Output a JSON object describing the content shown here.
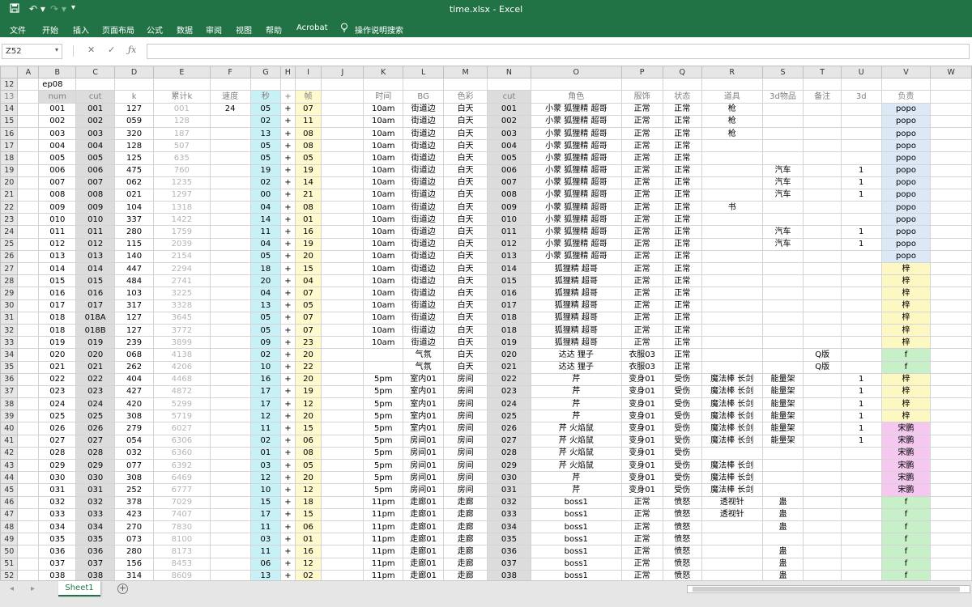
{
  "window": {
    "title": "time.xlsx",
    "separator": "-",
    "app": "Excel"
  },
  "ribbon_tabs": [
    "文件",
    "开始",
    "插入",
    "页面布局",
    "公式",
    "数据",
    "审阅",
    "视图",
    "帮助",
    "Acrobat"
  ],
  "tell_me": "操作说明搜索",
  "name_box": "Z52",
  "sheet_tab": "Sheet1",
  "columns": [
    "A",
    "B",
    "C",
    "D",
    "E",
    "F",
    "G",
    "H",
    "I",
    "J",
    "K",
    "L",
    "M",
    "N",
    "O",
    "P",
    "Q",
    "R",
    "S",
    "T",
    "U",
    "V",
    "W"
  ],
  "row12": {
    "row": "12",
    "b": "ep08"
  },
  "header_row": {
    "row": "13",
    "cells": [
      "",
      "num",
      "cut",
      "k",
      "累计k",
      "速度",
      "秒",
      "+",
      "帧",
      "",
      "时间",
      "BG",
      "色彩",
      "cut",
      "角色",
      "服饰",
      "状态",
      "道具",
      "3d物品",
      "备注",
      "3d",
      "负责",
      ""
    ]
  },
  "speed_value": "24",
  "rows": [
    {
      "r": "14",
      "num": "001",
      "cut": "001",
      "k": "127",
      "acc": "001",
      "sec": "05",
      "fr": "07",
      "time": "10am",
      "bg": "街道边",
      "color": "白天",
      "cut2": "001",
      "role": "小蒙 狐狸精 超哥",
      "cos": "正常",
      "state": "正常",
      "prop": "枪",
      "obj": "",
      "note": "",
      "d3": "",
      "owner": "popo",
      "oc": "blue"
    },
    {
      "r": "15",
      "num": "002",
      "cut": "002",
      "k": "059",
      "acc": "128",
      "sec": "02",
      "fr": "11",
      "time": "10am",
      "bg": "街道边",
      "color": "白天",
      "cut2": "002",
      "role": "小蒙 狐狸精 超哥",
      "cos": "正常",
      "state": "正常",
      "prop": "枪",
      "obj": "",
      "note": "",
      "d3": "",
      "owner": "popo",
      "oc": "blue"
    },
    {
      "r": "16",
      "num": "003",
      "cut": "003",
      "k": "320",
      "acc": "187",
      "sec": "13",
      "fr": "08",
      "time": "10am",
      "bg": "街道边",
      "color": "白天",
      "cut2": "003",
      "role": "小蒙 狐狸精 超哥",
      "cos": "正常",
      "state": "正常",
      "prop": "枪",
      "obj": "",
      "note": "",
      "d3": "",
      "owner": "popo",
      "oc": "blue"
    },
    {
      "r": "17",
      "num": "004",
      "cut": "004",
      "k": "128",
      "acc": "507",
      "sec": "05",
      "fr": "08",
      "time": "10am",
      "bg": "街道边",
      "color": "白天",
      "cut2": "004",
      "role": "小蒙 狐狸精 超哥",
      "cos": "正常",
      "state": "正常",
      "prop": "",
      "obj": "",
      "note": "",
      "d3": "",
      "owner": "popo",
      "oc": "blue"
    },
    {
      "r": "18",
      "num": "005",
      "cut": "005",
      "k": "125",
      "acc": "635",
      "sec": "05",
      "fr": "05",
      "time": "10am",
      "bg": "街道边",
      "color": "白天",
      "cut2": "005",
      "role": "小蒙 狐狸精 超哥",
      "cos": "正常",
      "state": "正常",
      "prop": "",
      "obj": "",
      "note": "",
      "d3": "",
      "owner": "popo",
      "oc": "blue"
    },
    {
      "r": "19",
      "num": "006",
      "cut": "006",
      "k": "475",
      "acc": "760",
      "sec": "19",
      "fr": "19",
      "time": "10am",
      "bg": "街道边",
      "color": "白天",
      "cut2": "006",
      "role": "小蒙 狐狸精 超哥",
      "cos": "正常",
      "state": "正常",
      "prop": "",
      "obj": "汽车",
      "note": "",
      "d3": "1",
      "owner": "popo",
      "oc": "blue"
    },
    {
      "r": "20",
      "num": "007",
      "cut": "007",
      "k": "062",
      "acc": "1235",
      "sec": "02",
      "fr": "14",
      "time": "10am",
      "bg": "街道边",
      "color": "白天",
      "cut2": "007",
      "role": "小蒙 狐狸精 超哥",
      "cos": "正常",
      "state": "正常",
      "prop": "",
      "obj": "汽车",
      "note": "",
      "d3": "1",
      "owner": "popo",
      "oc": "blue"
    },
    {
      "r": "21",
      "num": "008",
      "cut": "008",
      "k": "021",
      "acc": "1297",
      "sec": "00",
      "fr": "21",
      "time": "10am",
      "bg": "街道边",
      "color": "白天",
      "cut2": "008",
      "role": "小蒙 狐狸精 超哥",
      "cos": "正常",
      "state": "正常",
      "prop": "",
      "obj": "汽车",
      "note": "",
      "d3": "1",
      "owner": "popo",
      "oc": "blue"
    },
    {
      "r": "22",
      "num": "009",
      "cut": "009",
      "k": "104",
      "acc": "1318",
      "sec": "04",
      "fr": "08",
      "time": "10am",
      "bg": "街道边",
      "color": "白天",
      "cut2": "009",
      "role": "小蒙 狐狸精 超哥",
      "cos": "正常",
      "state": "正常",
      "prop": "书",
      "obj": "",
      "note": "",
      "d3": "",
      "owner": "popo",
      "oc": "blue"
    },
    {
      "r": "23",
      "num": "010",
      "cut": "010",
      "k": "337",
      "acc": "1422",
      "sec": "14",
      "fr": "01",
      "time": "10am",
      "bg": "街道边",
      "color": "白天",
      "cut2": "010",
      "role": "小蒙 狐狸精 超哥",
      "cos": "正常",
      "state": "正常",
      "prop": "",
      "obj": "",
      "note": "",
      "d3": "",
      "owner": "popo",
      "oc": "blue"
    },
    {
      "r": "24",
      "num": "011",
      "cut": "011",
      "k": "280",
      "acc": "1759",
      "sec": "11",
      "fr": "16",
      "time": "10am",
      "bg": "街道边",
      "color": "白天",
      "cut2": "011",
      "role": "小蒙 狐狸精 超哥",
      "cos": "正常",
      "state": "正常",
      "prop": "",
      "obj": "汽车",
      "note": "",
      "d3": "1",
      "owner": "popo",
      "oc": "blue"
    },
    {
      "r": "25",
      "num": "012",
      "cut": "012",
      "k": "115",
      "acc": "2039",
      "sec": "04",
      "fr": "19",
      "time": "10am",
      "bg": "街道边",
      "color": "白天",
      "cut2": "012",
      "role": "小蒙 狐狸精 超哥",
      "cos": "正常",
      "state": "正常",
      "prop": "",
      "obj": "汽车",
      "note": "",
      "d3": "1",
      "owner": "popo",
      "oc": "blue"
    },
    {
      "r": "26",
      "num": "013",
      "cut": "013",
      "k": "140",
      "acc": "2154",
      "sec": "05",
      "fr": "20",
      "time": "10am",
      "bg": "街道边",
      "color": "白天",
      "cut2": "013",
      "role": "小蒙 狐狸精 超哥",
      "cos": "正常",
      "state": "正常",
      "prop": "",
      "obj": "",
      "note": "",
      "d3": "",
      "owner": "popo",
      "oc": "blue"
    },
    {
      "r": "27",
      "num": "014",
      "cut": "014",
      "k": "447",
      "acc": "2294",
      "sec": "18",
      "fr": "15",
      "time": "10am",
      "bg": "街道边",
      "color": "白天",
      "cut2": "014",
      "role": "狐狸精 超哥",
      "cos": "正常",
      "state": "正常",
      "prop": "",
      "obj": "",
      "note": "",
      "d3": "",
      "owner": "梓",
      "oc": "ylw"
    },
    {
      "r": "28",
      "num": "015",
      "cut": "015",
      "k": "484",
      "acc": "2741",
      "sec": "20",
      "fr": "04",
      "time": "10am",
      "bg": "街道边",
      "color": "白天",
      "cut2": "015",
      "role": "狐狸精 超哥",
      "cos": "正常",
      "state": "正常",
      "prop": "",
      "obj": "",
      "note": "",
      "d3": "",
      "owner": "梓",
      "oc": "ylw"
    },
    {
      "r": "29",
      "num": "016",
      "cut": "016",
      "k": "103",
      "acc": "3225",
      "sec": "04",
      "fr": "07",
      "time": "10am",
      "bg": "街道边",
      "color": "白天",
      "cut2": "016",
      "role": "狐狸精 超哥",
      "cos": "正常",
      "state": "正常",
      "prop": "",
      "obj": "",
      "note": "",
      "d3": "",
      "owner": "梓",
      "oc": "ylw"
    },
    {
      "r": "30",
      "num": "017",
      "cut": "017",
      "k": "317",
      "acc": "3328",
      "sec": "13",
      "fr": "05",
      "time": "10am",
      "bg": "街道边",
      "color": "白天",
      "cut2": "017",
      "role": "狐狸精 超哥",
      "cos": "正常",
      "state": "正常",
      "prop": "",
      "obj": "",
      "note": "",
      "d3": "",
      "owner": "梓",
      "oc": "ylw"
    },
    {
      "r": "31",
      "num": "018",
      "cut": "018A",
      "k": "127",
      "acc": "3645",
      "sec": "05",
      "fr": "07",
      "time": "10am",
      "bg": "街道边",
      "color": "白天",
      "cut2": "018",
      "role": "狐狸精 超哥",
      "cos": "正常",
      "state": "正常",
      "prop": "",
      "obj": "",
      "note": "",
      "d3": "",
      "owner": "梓",
      "oc": "ylw"
    },
    {
      "r": "32",
      "num": "018",
      "cut": "018B",
      "k": "127",
      "acc": "3772",
      "sec": "05",
      "fr": "07",
      "time": "10am",
      "bg": "街道边",
      "color": "白天",
      "cut2": "018",
      "role": "狐狸精 超哥",
      "cos": "正常",
      "state": "正常",
      "prop": "",
      "obj": "",
      "note": "",
      "d3": "",
      "owner": "梓",
      "oc": "ylw"
    },
    {
      "r": "33",
      "num": "019",
      "cut": "019",
      "k": "239",
      "acc": "3899",
      "sec": "09",
      "fr": "23",
      "time": "10am",
      "bg": "街道边",
      "color": "白天",
      "cut2": "019",
      "role": "狐狸精 超哥",
      "cos": "正常",
      "state": "正常",
      "prop": "",
      "obj": "",
      "note": "",
      "d3": "",
      "owner": "梓",
      "oc": "ylw"
    },
    {
      "r": "34",
      "num": "020",
      "cut": "020",
      "k": "068",
      "acc": "4138",
      "sec": "02",
      "fr": "20",
      "time": "",
      "bg": "气氛",
      "color": "白天",
      "cut2": "020",
      "role": "达达 狸子",
      "cos": "衣服03",
      "state": "正常",
      "prop": "",
      "obj": "",
      "note": "Q版",
      "d3": "",
      "owner": "f",
      "oc": "grn"
    },
    {
      "r": "35",
      "num": "021",
      "cut": "021",
      "k": "262",
      "acc": "4206",
      "sec": "10",
      "fr": "22",
      "time": "",
      "bg": "气氛",
      "color": "白天",
      "cut2": "021",
      "role": "达达 狸子",
      "cos": "衣服03",
      "state": "正常",
      "prop": "",
      "obj": "",
      "note": "Q版",
      "d3": "",
      "owner": "f",
      "oc": "grn"
    },
    {
      "r": "36",
      "num": "022",
      "cut": "022",
      "k": "404",
      "acc": "4468",
      "sec": "16",
      "fr": "20",
      "time": "5pm",
      "bg": "室内01",
      "color": "房间",
      "cut2": "022",
      "role": "芹",
      "cos": "变身01",
      "state": "受伤",
      "prop": "魔法棒 长剑",
      "obj": "能量架",
      "note": "",
      "d3": "1",
      "owner": "梓",
      "oc": "ylw"
    },
    {
      "r": "37",
      "num": "023",
      "cut": "023",
      "k": "427",
      "acc": "4872",
      "sec": "17",
      "fr": "19",
      "time": "5pm",
      "bg": "室内01",
      "color": "房间",
      "cut2": "023",
      "role": "芹",
      "cos": "变身01",
      "state": "受伤",
      "prop": "魔法棒 长剑",
      "obj": "能量架",
      "note": "",
      "d3": "1",
      "owner": "梓",
      "oc": "ylw"
    },
    {
      "r": "38",
      "num": "024",
      "cut": "024",
      "k": "420",
      "acc": "5299",
      "sec": "17",
      "fr": "12",
      "time": "5pm",
      "bg": "室内01",
      "color": "房间",
      "cut2": "024",
      "role": "芹",
      "cos": "变身01",
      "state": "受伤",
      "prop": "魔法棒 长剑",
      "obj": "能量架",
      "note": "",
      "d3": "1",
      "owner": "梓",
      "oc": "ylw"
    },
    {
      "r": "39",
      "num": "025",
      "cut": "025",
      "k": "308",
      "acc": "5719",
      "sec": "12",
      "fr": "20",
      "time": "5pm",
      "bg": "室内01",
      "color": "房间",
      "cut2": "025",
      "role": "芹",
      "cos": "变身01",
      "state": "受伤",
      "prop": "魔法棒 长剑",
      "obj": "能量架",
      "note": "",
      "d3": "1",
      "owner": "梓",
      "oc": "ylw"
    },
    {
      "r": "40",
      "num": "026",
      "cut": "026",
      "k": "279",
      "acc": "6027",
      "sec": "11",
      "fr": "15",
      "time": "5pm",
      "bg": "室内01",
      "color": "房间",
      "cut2": "026",
      "role": "芹 火焰鼠",
      "cos": "变身01",
      "state": "受伤",
      "prop": "魔法棒 长剑",
      "obj": "能量架",
      "note": "",
      "d3": "1",
      "owner": "宋鹏",
      "oc": "pnk"
    },
    {
      "r": "41",
      "num": "027",
      "cut": "027",
      "k": "054",
      "acc": "6306",
      "sec": "02",
      "fr": "06",
      "time": "5pm",
      "bg": "房间01",
      "color": "房间",
      "cut2": "027",
      "role": "芹 火焰鼠",
      "cos": "变身01",
      "state": "受伤",
      "prop": "魔法棒 长剑",
      "obj": "能量架",
      "note": "",
      "d3": "1",
      "owner": "宋鹏",
      "oc": "pnk"
    },
    {
      "r": "42",
      "num": "028",
      "cut": "028",
      "k": "032",
      "acc": "6360",
      "sec": "01",
      "fr": "08",
      "time": "5pm",
      "bg": "房间01",
      "color": "房间",
      "cut2": "028",
      "role": "芹 火焰鼠",
      "cos": "变身01",
      "state": "受伤",
      "prop": "",
      "obj": "",
      "note": "",
      "d3": "",
      "owner": "宋鹏",
      "oc": "pnk"
    },
    {
      "r": "43",
      "num": "029",
      "cut": "029",
      "k": "077",
      "acc": "6392",
      "sec": "03",
      "fr": "05",
      "time": "5pm",
      "bg": "房间01",
      "color": "房间",
      "cut2": "029",
      "role": "芹 火焰鼠",
      "cos": "变身01",
      "state": "受伤",
      "prop": "魔法棒 长剑",
      "obj": "",
      "note": "",
      "d3": "",
      "owner": "宋鹏",
      "oc": "pnk"
    },
    {
      "r": "44",
      "num": "030",
      "cut": "030",
      "k": "308",
      "acc": "6469",
      "sec": "12",
      "fr": "20",
      "time": "5pm",
      "bg": "房间01",
      "color": "房间",
      "cut2": "030",
      "role": "芹",
      "cos": "变身01",
      "state": "受伤",
      "prop": "魔法棒 长剑",
      "obj": "",
      "note": "",
      "d3": "",
      "owner": "宋鹏",
      "oc": "pnk"
    },
    {
      "r": "45",
      "num": "031",
      "cut": "031",
      "k": "252",
      "acc": "6777",
      "sec": "10",
      "fr": "12",
      "time": "5pm",
      "bg": "房间01",
      "color": "房间",
      "cut2": "031",
      "role": "芹",
      "cos": "变身01",
      "state": "受伤",
      "prop": "魔法棒 长剑",
      "obj": "",
      "note": "",
      "d3": "",
      "owner": "宋鹏",
      "oc": "pnk"
    },
    {
      "r": "46",
      "num": "032",
      "cut": "032",
      "k": "378",
      "acc": "7029",
      "sec": "15",
      "fr": "18",
      "time": "11pm",
      "bg": "走廊01",
      "color": "走廊",
      "cut2": "032",
      "role": "boss1",
      "cos": "正常",
      "state": "愤怒",
      "prop": "透视针",
      "obj": "蛊",
      "note": "",
      "d3": "",
      "owner": "f",
      "oc": "grn"
    },
    {
      "r": "47",
      "num": "033",
      "cut": "033",
      "k": "423",
      "acc": "7407",
      "sec": "17",
      "fr": "15",
      "time": "11pm",
      "bg": "走廊01",
      "color": "走廊",
      "cut2": "033",
      "role": "boss1",
      "cos": "正常",
      "state": "愤怒",
      "prop": "透视针",
      "obj": "蛊",
      "note": "",
      "d3": "",
      "owner": "f",
      "oc": "grn"
    },
    {
      "r": "48",
      "num": "034",
      "cut": "034",
      "k": "270",
      "acc": "7830",
      "sec": "11",
      "fr": "06",
      "time": "11pm",
      "bg": "走廊01",
      "color": "走廊",
      "cut2": "034",
      "role": "boss1",
      "cos": "正常",
      "state": "愤怒",
      "prop": "",
      "obj": "蛊",
      "note": "",
      "d3": "",
      "owner": "f",
      "oc": "grn"
    },
    {
      "r": "49",
      "num": "035",
      "cut": "035",
      "k": "073",
      "acc": "8100",
      "sec": "03",
      "fr": "01",
      "time": "11pm",
      "bg": "走廊01",
      "color": "走廊",
      "cut2": "035",
      "role": "boss1",
      "cos": "正常",
      "state": "愤怒",
      "prop": "",
      "obj": "",
      "note": "",
      "d3": "",
      "owner": "f",
      "oc": "grn"
    },
    {
      "r": "50",
      "num": "036",
      "cut": "036",
      "k": "280",
      "acc": "8173",
      "sec": "11",
      "fr": "16",
      "time": "11pm",
      "bg": "走廊01",
      "color": "走廊",
      "cut2": "036",
      "role": "boss1",
      "cos": "正常",
      "state": "愤怒",
      "prop": "",
      "obj": "蛊",
      "note": "",
      "d3": "",
      "owner": "f",
      "oc": "grn"
    },
    {
      "r": "51",
      "num": "037",
      "cut": "037",
      "k": "156",
      "acc": "8453",
      "sec": "06",
      "fr": "12",
      "time": "11pm",
      "bg": "走廊01",
      "color": "走廊",
      "cut2": "037",
      "role": "boss1",
      "cos": "正常",
      "state": "愤怒",
      "prop": "",
      "obj": "蛊",
      "note": "",
      "d3": "",
      "owner": "f",
      "oc": "grn"
    },
    {
      "r": "52",
      "num": "038",
      "cut": "038",
      "k": "314",
      "acc": "8609",
      "sec": "13",
      "fr": "02",
      "time": "11pm",
      "bg": "走廊01",
      "color": "走廊",
      "cut2": "038",
      "role": "boss1",
      "cos": "正常",
      "state": "愤怒",
      "prop": "",
      "obj": "蛊",
      "note": "",
      "d3": "",
      "owner": "f",
      "oc": "grn"
    }
  ]
}
